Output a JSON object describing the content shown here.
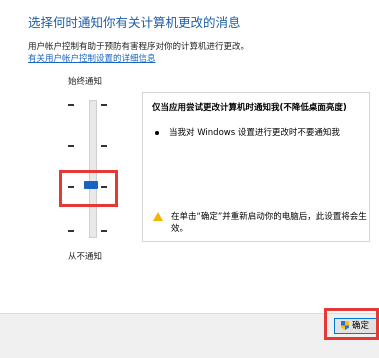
{
  "header": {
    "title": "选择何时通知你有关计算机更改的消息",
    "description": "用户帐户控制有助于预防有害程序对你的计算机进行更改。",
    "help_link": "有关用户帐户控制设置的详细信息"
  },
  "slider": {
    "top_label": "始终通知",
    "bottom_label": "从不通知",
    "levels": 4,
    "selected_level": 2
  },
  "panel": {
    "title": "仅当应用尝试更改计算机时通知我(不降低桌面亮度)",
    "bullet": "当我对 Windows 设置进行更改时不要通知我",
    "warning": "在单击“确定”并重新启动你的电脑后，此设置将会生效。"
  },
  "footer": {
    "ok_label": "确定"
  },
  "colors": {
    "heading": "#1f5ea8",
    "link": "#1a66c2",
    "thumb": "#1565c0",
    "highlight": "#e53935",
    "warning": "#f2b600"
  }
}
